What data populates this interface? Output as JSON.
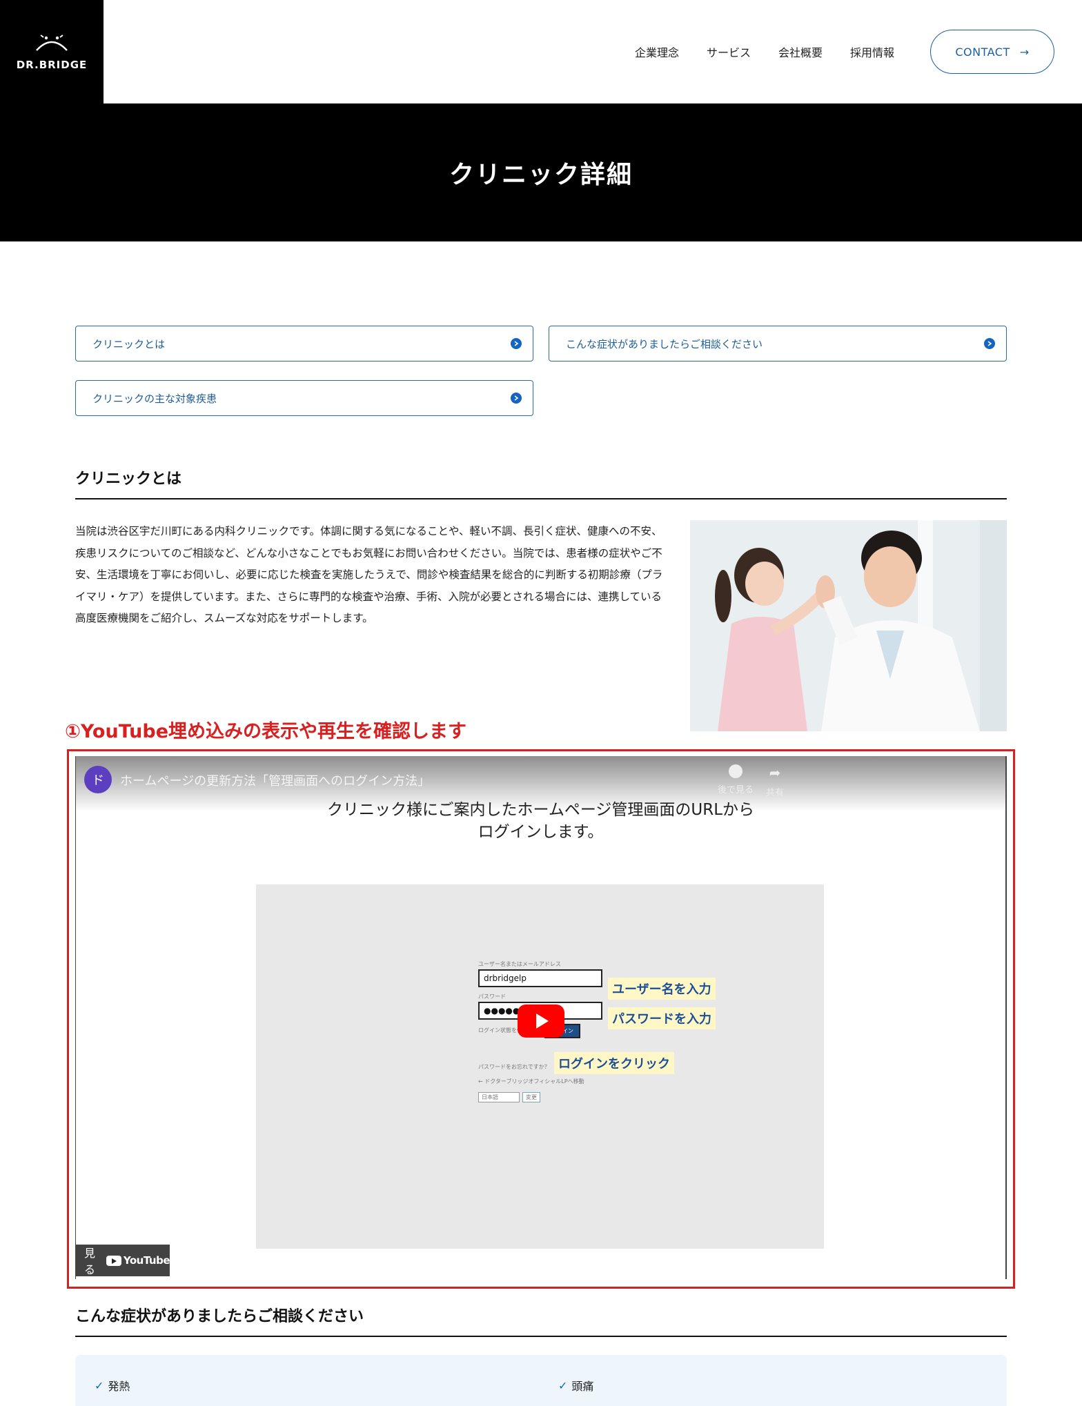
{
  "header": {
    "logo_text": "DR.BRIDGE",
    "nav": [
      "企業理念",
      "サービス",
      "会社概要",
      "採用情報"
    ],
    "contact_label": "CONTACT"
  },
  "hero": {
    "title": "クリニック詳細"
  },
  "anchors": [
    "クリニックとは",
    "こんな症状がありましたらご相談ください",
    "クリニックの主な対象疾患"
  ],
  "section1": {
    "title": "クリニックとは",
    "body": "当院は渋谷区宇だ川町にある内科クリニックです。体調に関する気になることや、軽い不調、長引く症状、健康への不安、疾患リスクについてのご相談など、どんな小さなことでもお気軽にお問い合わせください。当院では、患者様の症状やご不安、生活環境を丁寧にお伺いし、必要に応じた検査を実施したうえで、問診や検査結果を総合的に判断する初期診療（プライマリ・ケア）を提供しています。また、さらに専門的な検査や治療、手術、入院が必要とされる場合には、連携している高度医療機関をご紹介し、スムーズな対応をサポートします。"
  },
  "annotation": "①YouTube埋め込みの表示や再生を確認します",
  "video": {
    "channel_initial": "ド",
    "title": "ホームページの更新方法「管理画面へのログイン方法」",
    "watch_later": "後で見る",
    "share": "共有",
    "caption_line1": "クリニック様にご案内したホームページ管理画面のURLから",
    "caption_line2": "ログインします。",
    "login": {
      "user_label": "ユーザー名またはメールアドレス",
      "user_value": "drbridgelp",
      "pass_label": "パスワード",
      "pass_value": "●●●●●",
      "remember": "ログイン状態を保存する",
      "login_btn": "ログイン",
      "forgot": "パスワードをお忘れですか？",
      "back": "← ドクターブリッジオフィシャルLPへ移動",
      "lang": "日本語",
      "change": "変更"
    },
    "hl_user": "ユーザー名を入力",
    "hl_pass": "パスワードを入力",
    "hl_login": "ログインをクリック",
    "watch_label": "見る",
    "yt_label": "YouTube"
  },
  "section2": {
    "title": "こんな症状がありましたらご相談ください",
    "items": [
      "発熱",
      "頭痛"
    ]
  },
  "colors": {
    "accent": "#1a5fa0",
    "annotation": "#d92020",
    "hero_bg": "#000000"
  }
}
